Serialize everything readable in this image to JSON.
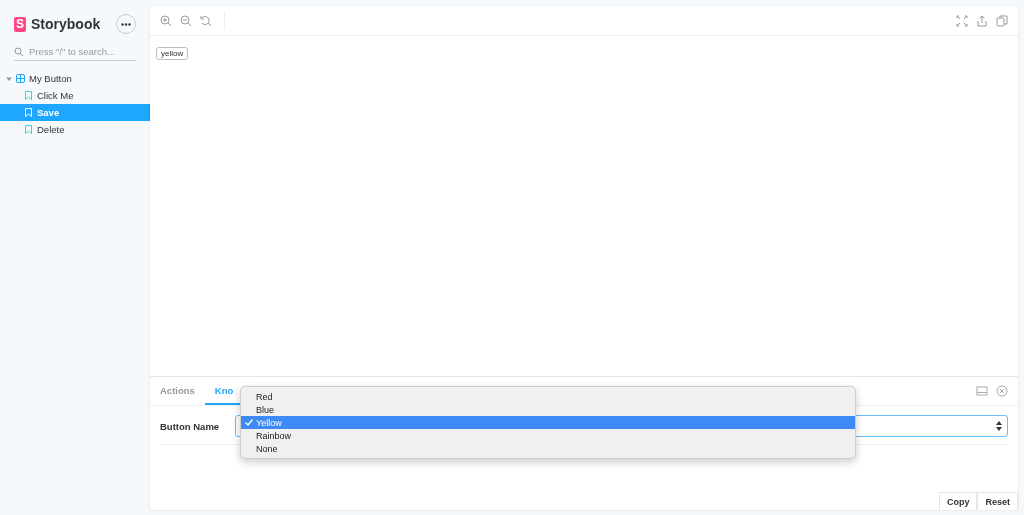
{
  "sidebar": {
    "logo_letter": "S",
    "title": "Storybook",
    "search": {
      "placeholder": "Press \"/\" to search..."
    },
    "tree": [
      {
        "label": "My Button",
        "expanded": true,
        "selected": false,
        "children": [
          {
            "label": "Click Me",
            "selected": false
          },
          {
            "label": "Save",
            "selected": true
          },
          {
            "label": "Delete",
            "selected": false
          }
        ]
      }
    ]
  },
  "preview": {
    "tag": "yellow"
  },
  "addons": {
    "tabs": [
      {
        "label": "Actions",
        "selected": false
      },
      {
        "label": "Kno",
        "selected": true
      }
    ],
    "knobs": [
      {
        "label": "Button Name"
      }
    ],
    "dropdown": {
      "options": [
        {
          "label": "Red",
          "selected": false
        },
        {
          "label": "Blue",
          "selected": false
        },
        {
          "label": "Yellow",
          "selected": true
        },
        {
          "label": "Rainbow",
          "selected": false
        },
        {
          "label": "None",
          "selected": false
        }
      ]
    },
    "buttons": [
      "Copy",
      "Reset"
    ]
  }
}
